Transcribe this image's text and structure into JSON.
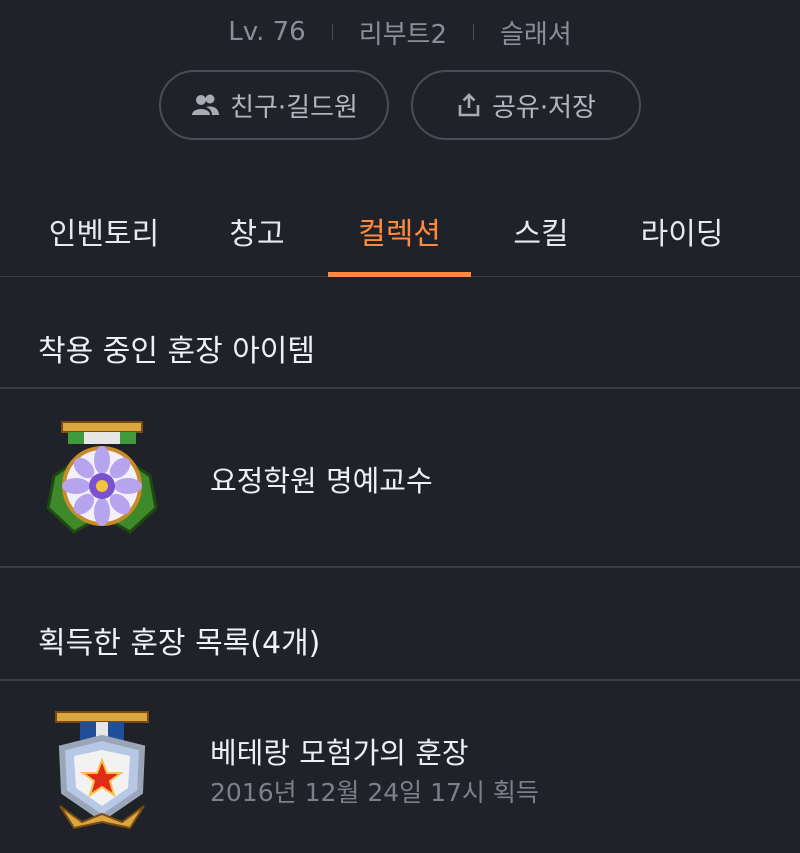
{
  "profile": {
    "level": "Lv. 76",
    "world": "리부트2",
    "job": "슬래셔"
  },
  "actions": {
    "friends_label": "친구·길드원",
    "share_label": "공유·저장"
  },
  "tabs": [
    {
      "label": "인벤토리",
      "active": false
    },
    {
      "label": "창고",
      "active": false
    },
    {
      "label": "컬렉션",
      "active": true
    },
    {
      "label": "스킬",
      "active": false
    },
    {
      "label": "라이딩",
      "active": false
    }
  ],
  "equipped": {
    "heading": "착용 중인 훈장 아이템",
    "item": {
      "name": "요정학원 명예교수",
      "icon": "flower-medal-icon"
    }
  },
  "acquired": {
    "heading": "획득한 훈장 목록(4개)",
    "items": [
      {
        "name": "베테랑 모험가의 훈장",
        "date": "2016년 12월 24일 17시 획득",
        "icon": "star-shield-medal-icon"
      }
    ]
  },
  "colors": {
    "background": "#202229",
    "accent": "#ff8a3d",
    "muted_text": "#8b8e98",
    "divider": "#3a3d46"
  }
}
